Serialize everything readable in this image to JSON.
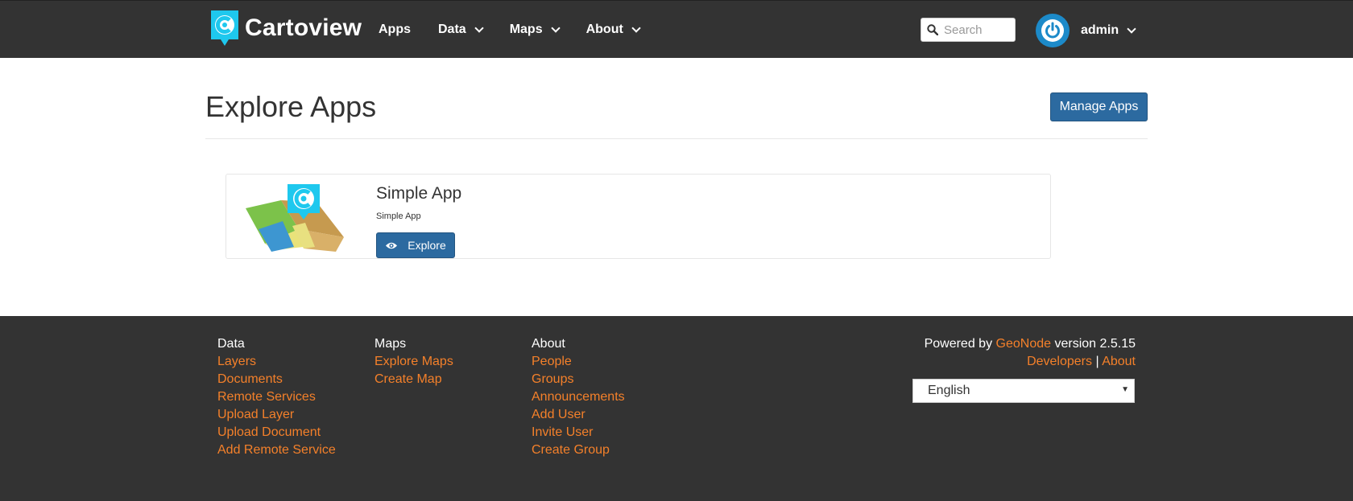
{
  "brand": {
    "name": "Cartoview"
  },
  "nav": {
    "items": [
      {
        "label": "Apps",
        "has_dropdown": false
      },
      {
        "label": "Data",
        "has_dropdown": true
      },
      {
        "label": "Maps",
        "has_dropdown": true
      },
      {
        "label": "About",
        "has_dropdown": true
      }
    ],
    "search": {
      "placeholder": "Search",
      "value": ""
    },
    "user": {
      "name": "admin"
    }
  },
  "page": {
    "title": "Explore Apps",
    "manage_button": "Manage Apps"
  },
  "apps": [
    {
      "name": "Simple App",
      "description": "Simple App",
      "explore_label": "Explore"
    }
  ],
  "footer": {
    "columns": [
      {
        "heading": "Data",
        "links": [
          "Layers",
          "Documents",
          "Remote Services",
          "Upload Layer",
          "Upload Document",
          "Add Remote Service"
        ]
      },
      {
        "heading": "Maps",
        "links": [
          "Explore Maps",
          "Create Map"
        ]
      },
      {
        "heading": "About",
        "links": [
          "People",
          "Groups",
          "Announcements",
          "Add User",
          "Invite User",
          "Create Group"
        ]
      }
    ],
    "powered_prefix": "Powered by",
    "powered_link": "GeoNode",
    "powered_suffix": "version 2.5.15",
    "developers": "Developers",
    "separator": "|",
    "about": "About",
    "language": "English"
  },
  "colors": {
    "navbar_bg": "#333333",
    "primary_button": "#2c6aa0",
    "link_orange": "#f4802a",
    "brand_cyan": "#1ec8ee"
  }
}
